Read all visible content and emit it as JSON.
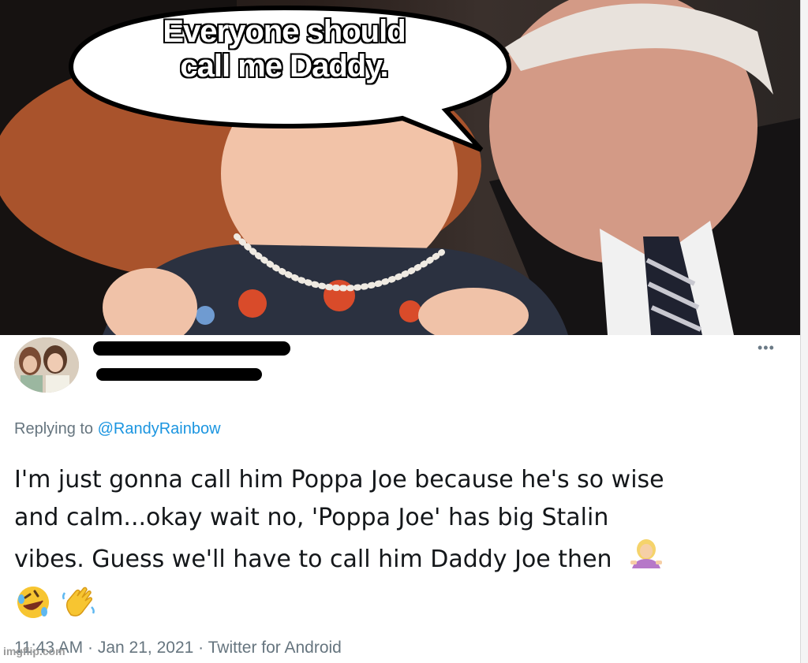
{
  "meme": {
    "caption_line1": "Everyone should",
    "caption_line2": "call me Daddy."
  },
  "tweet": {
    "more_icon": "•••",
    "replying_prefix": "Replying to",
    "replying_handle": "@RandyRainbow",
    "body_line1": "I'm just gonna call him Poppa Joe because he's so wise",
    "body_line2": "and calm...okay wait no, 'Poppa Joe' has big Stalin",
    "body_line3": "vibes. Guess we'll have to call him Daddy Joe then",
    "emojis": [
      "woman-shrugging",
      "rolling-on-floor-laughing",
      "waving-hand"
    ],
    "timestamp": "11:43 AM",
    "date": "Jan 21, 2021",
    "source": "Twitter for Android",
    "separator": "·"
  },
  "watermark": "imgflip.com",
  "colors": {
    "text": "#14171a",
    "muted": "#66757f",
    "link": "#1b95e0"
  }
}
